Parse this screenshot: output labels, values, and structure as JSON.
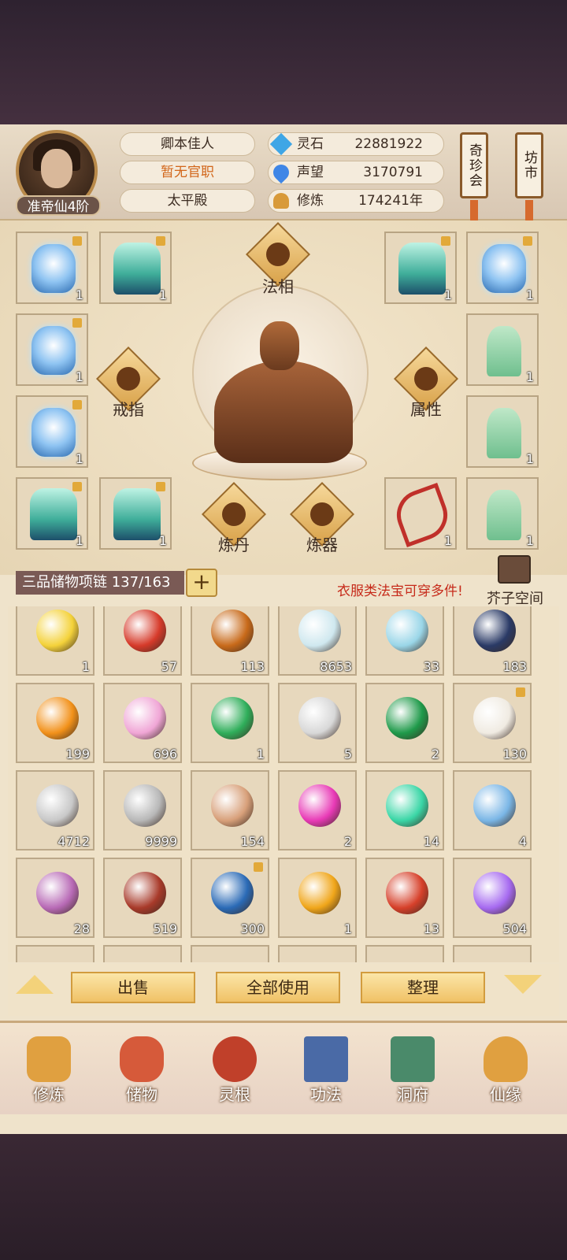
{
  "profile": {
    "rank": "准帝仙4阶",
    "name": "卿本佳人",
    "official_post": "暂无官职",
    "palace": "太平殿"
  },
  "stats": [
    {
      "label": "灵石",
      "value": "22881922",
      "icon": "spirit-stone-icon",
      "color": "#3fa6e6"
    },
    {
      "label": "声望",
      "value": "3170791",
      "icon": "prestige-icon",
      "color": "#3f86e6"
    },
    {
      "label": "修炼",
      "value": "174241年",
      "icon": "meditation-icon",
      "color": "#d89a3a"
    }
  ],
  "banners": {
    "treasure_hall": "奇珍会",
    "market": "坊市"
  },
  "equipment": {
    "center_labels": {
      "dharma_form": "法相",
      "ring": "戒指",
      "attributes": "属性",
      "alchemy": "炼丹",
      "forging": "炼器"
    },
    "left_slots": [
      {
        "item": "blue-armor",
        "count": "1",
        "locked": true
      },
      {
        "item": "teal-robe",
        "count": "1",
        "locked": true
      },
      {
        "item": "blue-armor",
        "count": "1",
        "locked": true
      },
      {
        "item": "blue-armor",
        "count": "1",
        "locked": true
      },
      {
        "item": "teal-robe",
        "count": "1",
        "locked": true
      },
      {
        "item": "teal-robe",
        "count": "1",
        "locked": true
      }
    ],
    "right_slots": [
      {
        "item": "teal-robe",
        "count": "1",
        "locked": true
      },
      {
        "item": "blue-armor",
        "count": "1",
        "locked": true
      },
      {
        "item": "green-robe",
        "count": "1",
        "locked": false
      },
      {
        "item": "green-robe",
        "count": "1",
        "locked": false
      },
      {
        "item": "bow",
        "count": "1",
        "locked": false
      },
      {
        "item": "green-robe",
        "count": "1",
        "locked": false
      }
    ]
  },
  "storage": {
    "container_label": "三品储物项链 137/163",
    "add_label": "+",
    "notice": "衣服类法宝可穿多件!",
    "space_label": "芥子空间"
  },
  "inventory": [
    {
      "count": "1",
      "color": "#f4d23a",
      "locked": false
    },
    {
      "count": "57",
      "color": "#d63a2a",
      "locked": false
    },
    {
      "count": "113",
      "color": "#c86a1a",
      "locked": false
    },
    {
      "count": "8653",
      "color": "#cfe8ef",
      "locked": false
    },
    {
      "count": "33",
      "color": "#9ad6e8",
      "locked": false
    },
    {
      "count": "183",
      "color": "#2a3a66",
      "locked": false
    },
    {
      "count": "199",
      "color": "#f2911a",
      "locked": false
    },
    {
      "count": "696",
      "color": "#f0a6d6",
      "locked": false
    },
    {
      "count": "1",
      "color": "#2fae5a",
      "locked": false
    },
    {
      "count": "5",
      "color": "#d8d8d8",
      "locked": false
    },
    {
      "count": "2",
      "color": "#1f9a4a",
      "locked": false
    },
    {
      "count": "130",
      "color": "#f0ebe2",
      "locked": true
    },
    {
      "count": "4712",
      "color": "#c8c8c8",
      "locked": false
    },
    {
      "count": "9999",
      "color": "#b8b8b8",
      "locked": false
    },
    {
      "count": "154",
      "color": "#d8a07a",
      "locked": false
    },
    {
      "count": "2",
      "color": "#e83ab6",
      "locked": false
    },
    {
      "count": "14",
      "color": "#3ad6a6",
      "locked": false
    },
    {
      "count": "4",
      "color": "#7ab6e6",
      "locked": false
    },
    {
      "count": "28",
      "color": "#b86ab6",
      "locked": false
    },
    {
      "count": "519",
      "color": "#a83a2a",
      "locked": false
    },
    {
      "count": "300",
      "color": "#2a6ab6",
      "locked": true
    },
    {
      "count": "1",
      "color": "#f0a61a",
      "locked": false
    },
    {
      "count": "13",
      "color": "#d6402a",
      "locked": false
    },
    {
      "count": "504",
      "color": "#a66af0",
      "locked": false
    }
  ],
  "actions": {
    "sell": "出售",
    "use_all": "全部使用",
    "sort": "整理"
  },
  "nav": [
    {
      "label": "修炼",
      "icon": "cultivation-icon",
      "color": "#e0a040"
    },
    {
      "label": "储物",
      "icon": "storage-bag-icon",
      "color": "#d65a3a"
    },
    {
      "label": "灵根",
      "icon": "spirit-root-icon",
      "color": "#c0402a"
    },
    {
      "label": "功法",
      "icon": "technique-book-icon",
      "color": "#4a6aa6"
    },
    {
      "label": "洞府",
      "icon": "cave-residence-icon",
      "color": "#4a8a6a"
    },
    {
      "label": "仙缘",
      "icon": "immortal-fate-icon",
      "color": "#e0a040"
    }
  ]
}
